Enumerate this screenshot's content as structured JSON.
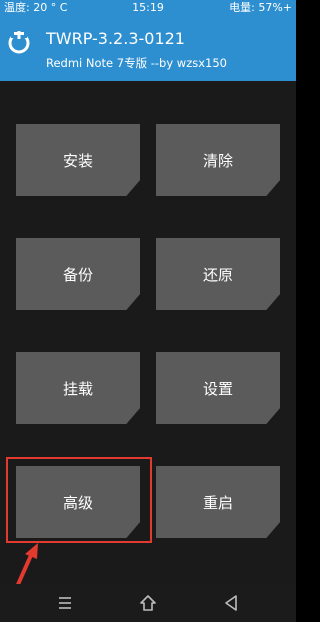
{
  "status_bar": {
    "left": "温度: 20 ° C",
    "time": "15:19",
    "battery": "电量: 57%+"
  },
  "header": {
    "title": "TWRP-3.2.3-0121",
    "subtitle": "Redmi Note 7专版  --by wzsx150"
  },
  "menu": {
    "install": "安装",
    "wipe": "清除",
    "backup": "备份",
    "restore": "还原",
    "mount": "挂载",
    "settings": "设置",
    "advanced": "高级",
    "reboot": "重启"
  },
  "colors": {
    "header_bg": "#2e8fd0",
    "button_bg": "#5b5b5b",
    "highlight": "#e33a2f"
  },
  "icons": {
    "logo": "twrp-logo-icon",
    "nav_menu": "menu-icon",
    "nav_home": "home-icon",
    "nav_back": "back-icon"
  }
}
